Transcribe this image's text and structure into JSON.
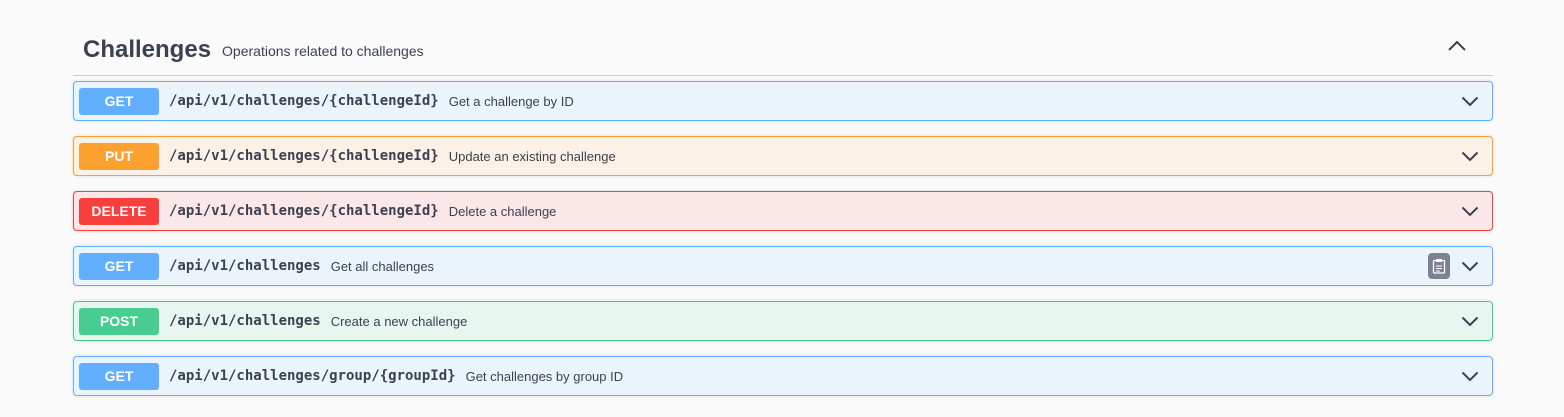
{
  "section": {
    "title": "Challenges",
    "description": "Operations related to challenges",
    "toggle_icon": "chevron-up-icon"
  },
  "operations": [
    {
      "method": "GET",
      "path": "/api/v1/challenges/{challengeId}",
      "summary": "Get a challenge by ID",
      "color": "#61affe"
    },
    {
      "method": "PUT",
      "path": "/api/v1/challenges/{challengeId}",
      "summary": "Update an existing challenge",
      "color": "#fca130"
    },
    {
      "method": "DELETE",
      "path": "/api/v1/challenges/{challengeId}",
      "summary": "Delete a challenge",
      "color": "#f93e3e"
    },
    {
      "method": "GET",
      "path": "/api/v1/challenges",
      "summary": "Get all challenges",
      "color": "#61affe",
      "copy_icon": "copy-clipboard-icon"
    },
    {
      "method": "POST",
      "path": "/api/v1/challenges",
      "summary": "Create a new challenge",
      "color": "#49cc90"
    },
    {
      "method": "GET",
      "path": "/api/v1/challenges/group/{groupId}",
      "summary": "Get challenges by group ID",
      "color": "#61affe"
    }
  ]
}
